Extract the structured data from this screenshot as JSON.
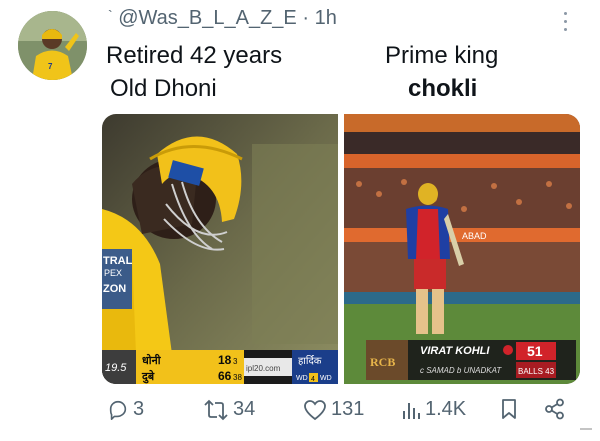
{
  "tweet": {
    "handle": "@Was_B_L_A_Z_E",
    "separator": "·",
    "time": "1h",
    "caption_left_line1": "Retired 42 years",
    "caption_left_line2": "Old Dhoni",
    "caption_right_line1": "Prime king",
    "caption_right_line2": "chokli"
  },
  "left_image": {
    "score_over": "19.5",
    "batter1_name": "धोनी",
    "batter1_runs": "18",
    "batter1_balls": "3",
    "batter2_name": "दुबे",
    "batter2_runs": "66",
    "batter2_balls": "38",
    "site": "ipl20.com",
    "bowler_name": "हार्दिक",
    "extras_prefix": "WD",
    "extras_count": "4",
    "extras_suffix": "WD",
    "sponsor_top": "TRAL",
    "sponsor_mid": "PEX",
    "sponsor_bottom": "ZON"
  },
  "right_image": {
    "batter_name": "VIRAT KOHLI",
    "batter_runs": "51",
    "dismissal": "c SAMAD b UNADKAT",
    "balls_label": "BALLS 43",
    "team_logo": "RCB",
    "billboard_text": "ABAD"
  },
  "actions": {
    "replies": "3",
    "retweets": "34",
    "likes": "131",
    "views": "1.4K"
  },
  "icons": [
    "reply-icon",
    "retweet-icon",
    "like-icon",
    "views-icon",
    "bookmark-icon",
    "share-icon",
    "more-icon"
  ],
  "colors": {
    "muted_text": "#536471",
    "primary_text": "#0f1419",
    "csk_yellow": "#f2c318",
    "rcb_red": "#d1232a"
  }
}
